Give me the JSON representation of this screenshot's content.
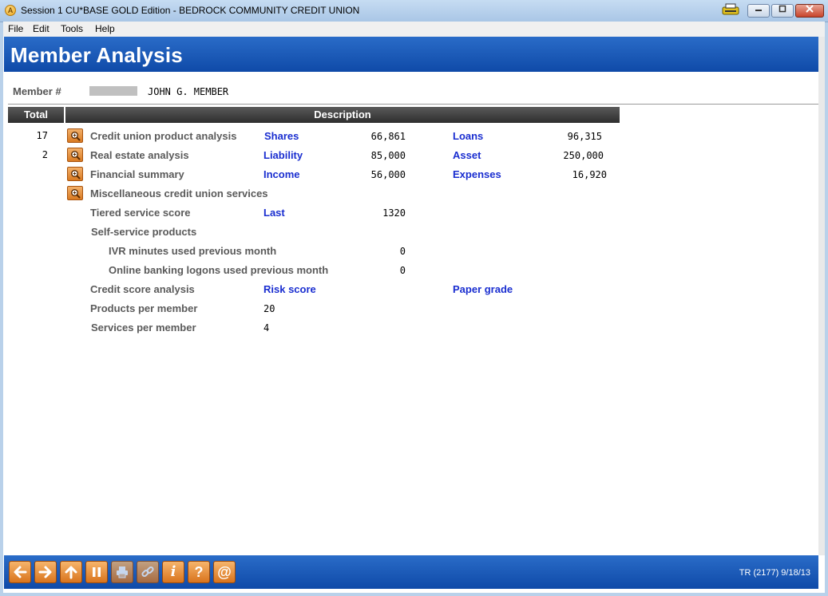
{
  "window": {
    "title": "Session 1 CU*BASE GOLD Edition - BEDROCK COMMUNITY CREDIT UNION",
    "app_icon_letter": "A"
  },
  "menu": [
    "File",
    "Edit",
    "Tools",
    "Help"
  ],
  "page": {
    "title": "Member Analysis"
  },
  "member": {
    "label": "Member #",
    "name": "JOHN G. MEMBER"
  },
  "columns": {
    "total": "Total",
    "description": "Description"
  },
  "rows": [
    {
      "total": "17",
      "desc": "Credit union product analysis",
      "label1": "Shares",
      "value1": "66,861",
      "label2": "Loans",
      "value2": "96,315"
    },
    {
      "total": "2",
      "desc": "Real estate analysis",
      "label1": "Liability",
      "value1": "85,000",
      "label2": "Asset",
      "value2": "250,000"
    },
    {
      "desc": "Financial summary",
      "label1": "Income",
      "value1": "56,000",
      "label2": "Expenses",
      "value2": "16,920"
    },
    {
      "desc": "Miscellaneous credit union services"
    },
    {
      "desc": "Tiered service score",
      "label1": "Last",
      "value1": "1320"
    },
    {
      "desc": "Self-service products"
    },
    {
      "desc": "IVR minutes used previous month",
      "value1": "0"
    },
    {
      "desc": "Online banking logons used previous month",
      "value1": "0"
    },
    {
      "desc": "Credit score analysis",
      "label1": "Risk score",
      "label2": "Paper grade"
    },
    {
      "desc": "Products per member",
      "value_left": "20"
    },
    {
      "desc": "Services per member",
      "value_left": "4"
    }
  ],
  "footer": {
    "buttons": [
      "back-arrow-icon",
      "forward-arrow-icon",
      "up-arrow-icon",
      "pause-icon",
      "print-icon",
      "link-icon",
      "info-icon",
      "help-icon",
      "at-sign-icon"
    ],
    "info_glyph": "i",
    "help_glyph": "?",
    "at_glyph": "@",
    "status": "TR (2177) 9/18/13"
  },
  "colors": {
    "header_blue": "#1a5cbc",
    "link_blue": "#1a2ed0",
    "button_orange": "#e8892e"
  }
}
